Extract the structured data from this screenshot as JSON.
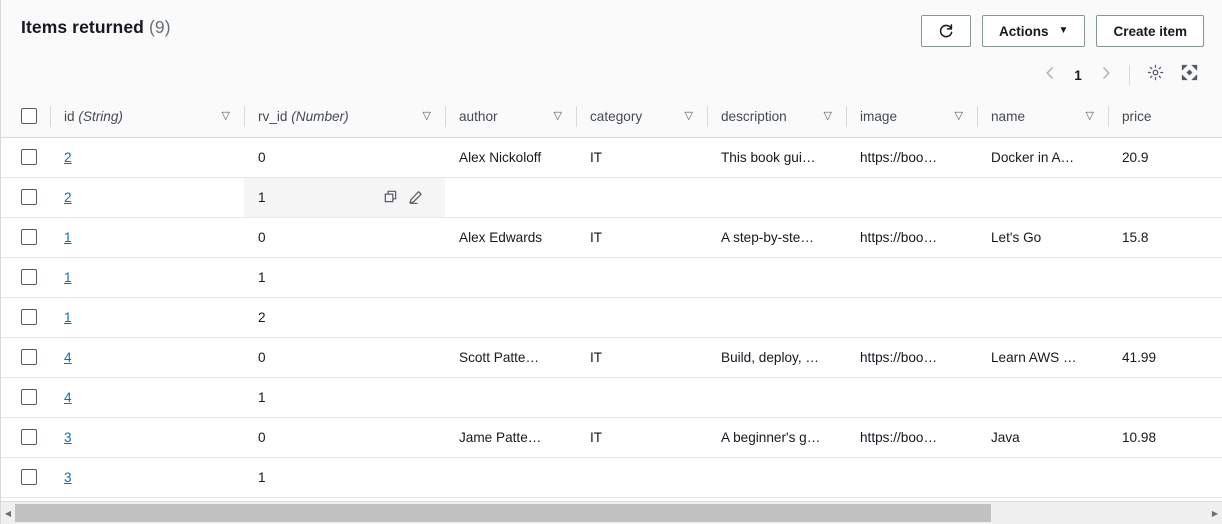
{
  "header": {
    "title": "Items returned",
    "count": "(9)",
    "refresh_icon": "refresh-icon",
    "actions_label": "Actions",
    "actions_caret": "▼",
    "create_label": "Create item"
  },
  "pagination": {
    "prev_icon": "chevron-left-icon",
    "page": "1",
    "next_icon": "chevron-right-icon",
    "settings_icon": "gear-icon",
    "fullscreen_icon": "fullscreen-icon"
  },
  "table": {
    "sort_icon": "▽",
    "columns": [
      {
        "label": "id",
        "type": "(String)"
      },
      {
        "label": "rv_id",
        "type": "(Number)"
      },
      {
        "label": "author",
        "type": ""
      },
      {
        "label": "category",
        "type": ""
      },
      {
        "label": "description",
        "type": ""
      },
      {
        "label": "image",
        "type": ""
      },
      {
        "label": "name",
        "type": ""
      },
      {
        "label": "price",
        "type": ""
      }
    ],
    "rows": [
      {
        "id": "2",
        "rv_id": "0",
        "author": "Alex Nickoloff",
        "category": "IT",
        "description": "This book gui…",
        "image": "https://boo…",
        "name": "Docker in A…",
        "price": "20.9"
      },
      {
        "id": "2",
        "rv_id": "1",
        "author": "",
        "category": "",
        "description": "",
        "image": "",
        "name": "",
        "price": ""
      },
      {
        "id": "1",
        "rv_id": "0",
        "author": "Alex Edwards",
        "category": "IT",
        "description": "A step-by-ste…",
        "image": "https://boo…",
        "name": "Let's Go",
        "price": "15.8"
      },
      {
        "id": "1",
        "rv_id": "1",
        "author": "",
        "category": "",
        "description": "",
        "image": "",
        "name": "",
        "price": ""
      },
      {
        "id": "1",
        "rv_id": "2",
        "author": "",
        "category": "",
        "description": "",
        "image": "",
        "name": "",
        "price": ""
      },
      {
        "id": "4",
        "rv_id": "0",
        "author": "Scott Patte…",
        "category": "IT",
        "description": "Build, deploy, …",
        "image": "https://boo…",
        "name": "Learn AWS …",
        "price": "41.99"
      },
      {
        "id": "4",
        "rv_id": "1",
        "author": "",
        "category": "",
        "description": "",
        "image": "",
        "name": "",
        "price": ""
      },
      {
        "id": "3",
        "rv_id": "0",
        "author": "Jame Patte…",
        "category": "IT",
        "description": "A beginner's g…",
        "image": "https://boo…",
        "name": "Java",
        "price": "10.98"
      },
      {
        "id": "3",
        "rv_id": "1",
        "author": "",
        "category": "",
        "description": "",
        "image": "",
        "name": "",
        "price": ""
      }
    ],
    "hovered_cell": {
      "row_index": 1,
      "column": "rv_id",
      "copy_icon": "copy-icon",
      "edit_icon": "edit-pencil-icon"
    }
  },
  "scrollbar": {
    "left_arrow": "◀",
    "right_arrow": "▶"
  },
  "colors": {
    "link": "#0073bb",
    "border": "#d5dbdb",
    "header_bg": "#fafafa",
    "hover_bg": "#f5f5f5",
    "muted_text": "#687078"
  }
}
